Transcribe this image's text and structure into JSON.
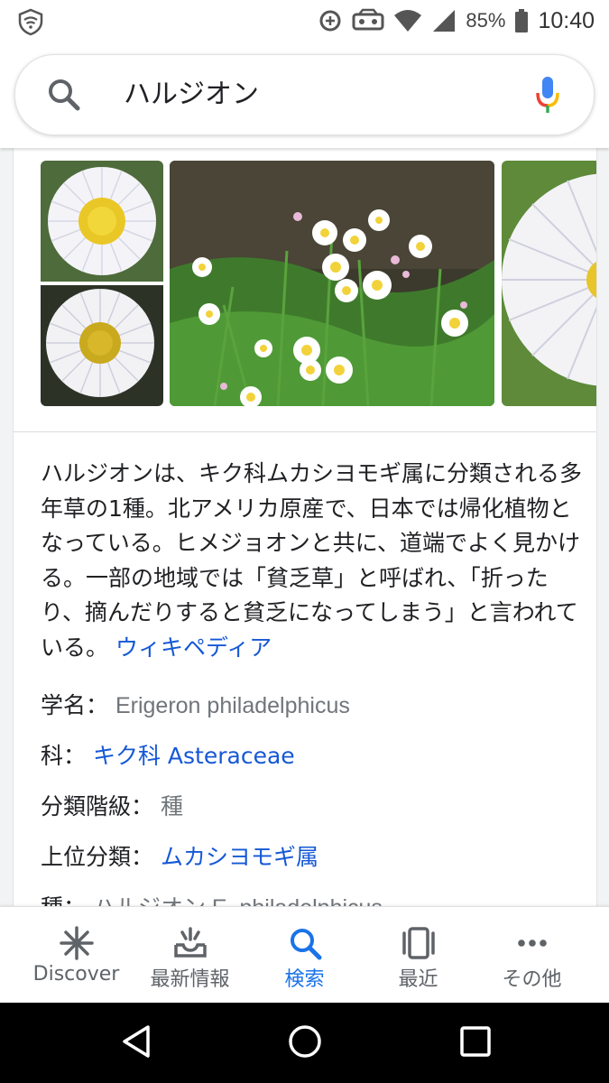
{
  "status_bar": {
    "battery": "85%",
    "time": "10:40"
  },
  "search": {
    "query": "ハルジオン"
  },
  "knowledge_panel": {
    "description": "ハルジオンは、キク科ムカシヨモギ属に分類される多年草の1種。北アメリカ原産で、日本では帰化植物となっている。ヒメジョオンと共に、道端でよく見かける。一部の地域では「貧乏草」と呼ばれ、「折ったり、摘んだりすると貧乏になってしまう」と言われている。",
    "source_link": "ウィキペディア",
    "facts": [
      {
        "label": "学名：",
        "value": "Erigeron philadelphicus",
        "link": false
      },
      {
        "label": "科：",
        "value": "キク科 Asteraceae",
        "link": true
      },
      {
        "label": "分類階級：",
        "value": "種",
        "link": false
      },
      {
        "label": "上位分類：",
        "value": "ムカシヨモギ属",
        "link": true
      },
      {
        "label": "種：",
        "value": "ハルジオン E. philadelphicus",
        "link": false
      }
    ]
  },
  "bottom_nav": [
    {
      "label": "Discover",
      "icon": "asterisk-icon",
      "active": false
    },
    {
      "label": "最新情報",
      "icon": "updates-tray-icon",
      "active": false
    },
    {
      "label": "検索",
      "icon": "search-icon",
      "active": true
    },
    {
      "label": "最近",
      "icon": "recent-cards-icon",
      "active": false
    },
    {
      "label": "その他",
      "icon": "more-horizontal-icon",
      "active": false
    }
  ],
  "colors": {
    "link": "#1558d6",
    "active_nav": "#1a73e8",
    "muted_text": "#70757a"
  }
}
